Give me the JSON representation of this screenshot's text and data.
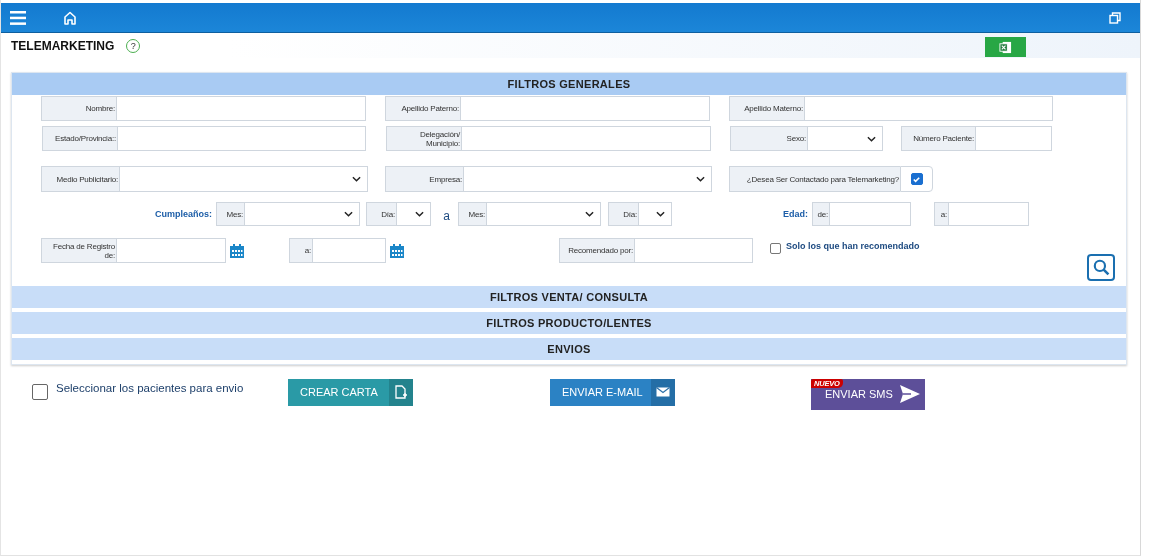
{
  "page": {
    "title": "TELEMARKETING",
    "help": "?"
  },
  "sections": [
    {
      "title": "FILTROS GENERALES",
      "expanded": true
    },
    {
      "title": "FILTROS VENTA/ CONSULTA",
      "expanded": false
    },
    {
      "title": "FILTROS PRODUCTO/LENTES",
      "expanded": false
    },
    {
      "title": "ENVIOS",
      "expanded": false
    }
  ],
  "filters": [
    [
      {
        "kind": "text",
        "label": "Nombre:"
      },
      {
        "kind": "text",
        "label": "Apellido Paterno:"
      },
      {
        "kind": "text",
        "label": "Apellido Materno:"
      }
    ],
    [
      {
        "kind": "text",
        "label": "Estado/Provincia::"
      },
      {
        "kind": "text",
        "label": "Delegación/ Municipio:"
      },
      {
        "kind": "select",
        "label": "Sexo:"
      },
      {
        "kind": "text",
        "label": "Número Paciente:"
      }
    ],
    [
      {
        "kind": "select",
        "label": "Medio Publicitario:"
      },
      {
        "kind": "select",
        "label": "Empresa:"
      },
      {
        "kind": "checkbox",
        "label": "¿Desea Ser Contactado para Telemarketing?",
        "checked": true
      }
    ],
    [
      {
        "kind": "caption",
        "label": "Cumpleaños:"
      },
      {
        "kind": "select",
        "label": "Mes:"
      },
      {
        "kind": "select",
        "label": "Día:"
      },
      {
        "kind": "word",
        "label": "a"
      },
      {
        "kind": "select",
        "label": "Mes:"
      },
      {
        "kind": "select",
        "label": "Día:"
      },
      {
        "kind": "caption",
        "label": "Edad:"
      },
      {
        "kind": "text",
        "label": "de:"
      },
      {
        "kind": "text",
        "label": "a:"
      }
    ],
    [
      {
        "kind": "date",
        "label": "Fecha de Registro de:"
      },
      {
        "kind": "date",
        "label": "a:"
      },
      {
        "kind": "text",
        "label": "Recomendado por:"
      },
      {
        "kind": "check",
        "label": "Solo los que han recomendado",
        "checked": false
      }
    ]
  ],
  "send": {
    "select_all": {
      "label": "Seleccionar los pacientes para envio",
      "checked": false
    },
    "buttons": [
      {
        "kind": "letter",
        "label": "CREAR CARTA"
      },
      {
        "kind": "email",
        "label": "ENVIAR E-MAIL"
      },
      {
        "kind": "sms",
        "label": "ENVIAR SMS",
        "badge": "NUEVO"
      }
    ]
  }
}
